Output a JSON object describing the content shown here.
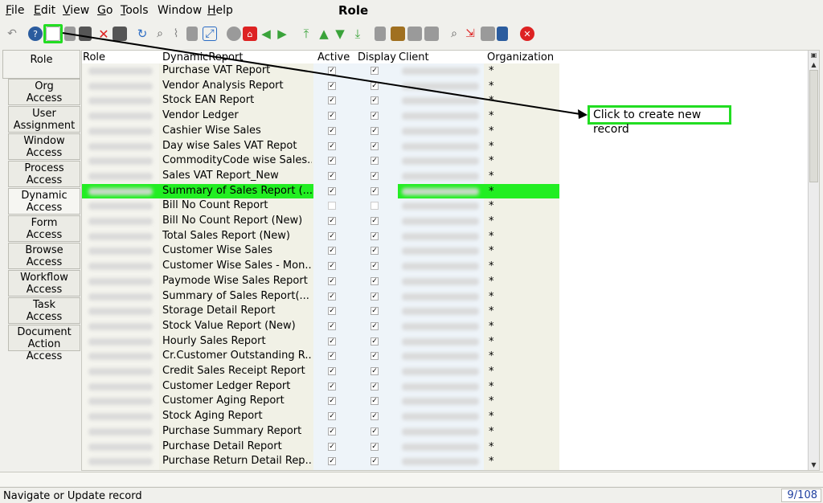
{
  "window": {
    "title": "Role"
  },
  "menu": [
    {
      "label": "File",
      "u": "F",
      "rest": "ile"
    },
    {
      "label": "Edit",
      "u": "E",
      "rest": "dit"
    },
    {
      "label": "View",
      "u": "V",
      "rest": "iew"
    },
    {
      "label": "Go",
      "u": "G",
      "rest": "o"
    },
    {
      "label": "Tools",
      "u": "T",
      "rest": "ools"
    },
    {
      "label": "Window",
      "u": "",
      "rest": "Window"
    },
    {
      "label": "Help",
      "u": "H",
      "rest": "elp"
    }
  ],
  "tabs": [
    {
      "label": "Role"
    },
    {
      "label": "Org\nAccess"
    },
    {
      "label": "User\nAssignment"
    },
    {
      "label": "Window\nAccess"
    },
    {
      "label": "Process\nAccess"
    },
    {
      "label": "Dynamic\nAccess"
    },
    {
      "label": "Form\nAccess"
    },
    {
      "label": "Browse\nAccess"
    },
    {
      "label": "Workflow\nAccess"
    },
    {
      "label": "Task\nAccess"
    },
    {
      "label": "Document\nAction Access"
    }
  ],
  "grid": {
    "headers": {
      "role": "Role",
      "report": "DynamicReport",
      "active": "Active",
      "display": "Display",
      "client": "Client",
      "org": "Organization"
    },
    "selected_index": 8,
    "rows": [
      {
        "report": "Purchase VAT Report",
        "active": true,
        "display": true,
        "org": "*"
      },
      {
        "report": "Vendor Analysis Report",
        "active": true,
        "display": true,
        "org": "*"
      },
      {
        "report": "Stock EAN Report",
        "active": true,
        "display": true,
        "org": "*"
      },
      {
        "report": "Vendor Ledger",
        "active": true,
        "display": true,
        "org": "*"
      },
      {
        "report": "Cashier Wise Sales",
        "active": true,
        "display": true,
        "org": "*"
      },
      {
        "report": "Day wise Sales VAT Repot",
        "active": true,
        "display": true,
        "org": "*"
      },
      {
        "report": "CommodityCode wise Sales...",
        "active": true,
        "display": true,
        "org": "*"
      },
      {
        "report": "Sales VAT Report_New",
        "active": true,
        "display": true,
        "org": "*"
      },
      {
        "report": "Summary of Sales Report (...",
        "active": true,
        "display": true,
        "org": "*"
      },
      {
        "report": "Bill No Count Report",
        "active": false,
        "display": false,
        "org": "*"
      },
      {
        "report": "Bill No Count Report (New)",
        "active": true,
        "display": true,
        "org": "*"
      },
      {
        "report": "Total Sales Report (New)",
        "active": true,
        "display": true,
        "org": "*"
      },
      {
        "report": "Customer Wise Sales",
        "active": true,
        "display": true,
        "org": "*"
      },
      {
        "report": "Customer Wise Sales - Mon...",
        "active": true,
        "display": true,
        "org": "*"
      },
      {
        "report": "Paymode Wise Sales Report",
        "active": true,
        "display": true,
        "org": "*"
      },
      {
        "report": "Summary of Sales Report(...",
        "active": true,
        "display": true,
        "org": "*"
      },
      {
        "report": "Storage Detail Report",
        "active": true,
        "display": true,
        "org": "*"
      },
      {
        "report": "Stock Value Report (New)",
        "active": true,
        "display": true,
        "org": "*"
      },
      {
        "report": "Hourly Sales Report",
        "active": true,
        "display": true,
        "org": "*"
      },
      {
        "report": "Cr.Customer Outstanding R...",
        "active": true,
        "display": true,
        "org": "*"
      },
      {
        "report": "Credit Sales Receipt Report",
        "active": true,
        "display": true,
        "org": "*"
      },
      {
        "report": "Customer Ledger Report",
        "active": true,
        "display": true,
        "org": "*"
      },
      {
        "report": "Customer Aging Report",
        "active": true,
        "display": true,
        "org": "*"
      },
      {
        "report": "Stock Aging Report",
        "active": true,
        "display": true,
        "org": "*"
      },
      {
        "report": "Purchase Summary Report",
        "active": true,
        "display": true,
        "org": "*"
      },
      {
        "report": "Purchase Detail Report",
        "active": true,
        "display": true,
        "org": "*"
      },
      {
        "report": "Purchase Return Detail Rep...",
        "active": true,
        "display": true,
        "org": "*"
      }
    ]
  },
  "callout": {
    "text": "Click to create new record"
  },
  "status": {
    "message": "Navigate or Update record",
    "count": "9/108"
  },
  "colors": {
    "highlight": "#22ee22",
    "accent": "#22dd22"
  },
  "toolbar_icons": [
    "undo-icon",
    "help-icon",
    "new-record-icon",
    "copy-icon",
    "save-icon",
    "delete-icon",
    "delete-selection-icon",
    "refresh-icon",
    "find-icon",
    "attachment-icon",
    "chat-icon",
    "grid-toggle-icon",
    "history-icon",
    "home-icon",
    "back-icon",
    "forward-icon",
    "first-icon",
    "previous-icon",
    "next-icon",
    "last-icon",
    "report-icon",
    "archive-icon",
    "print-icon",
    "print-preview-icon",
    "zoom-across-icon",
    "request-icon",
    "product-info-icon",
    "lock-icon",
    "end-icon"
  ]
}
